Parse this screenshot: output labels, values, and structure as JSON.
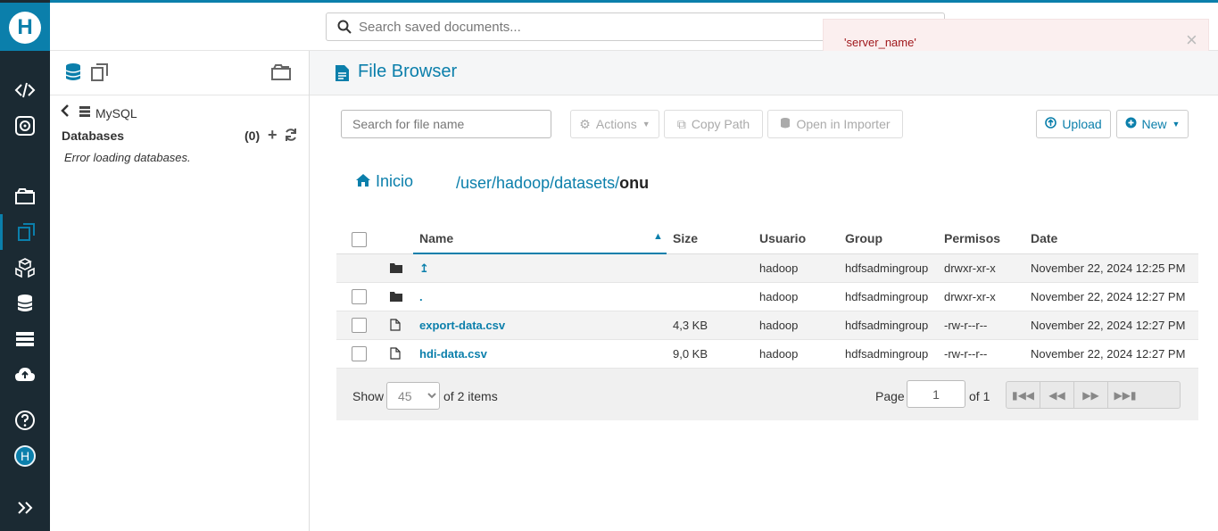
{
  "app": {
    "logo_letter": "H"
  },
  "rail": {
    "avatar_letter": "H"
  },
  "search": {
    "placeholder": "Search saved documents..."
  },
  "toast": {
    "message": "'server_name'",
    "close": "×"
  },
  "assist": {
    "crumb": "MySQL",
    "databases_label": "Databases",
    "databases_count": "(0)",
    "error": "Error loading databases."
  },
  "page": {
    "title": "File Browser"
  },
  "toolbar": {
    "file_search_placeholder": "Search for file name",
    "actions": "Actions",
    "copy_path": "Copy Path",
    "open_importer": "Open in Importer",
    "upload": "Upload",
    "new": "New"
  },
  "breadcrumb": {
    "home": "Inicio",
    "segments": [
      "/user",
      "/hadoop",
      "/datasets",
      "/",
      "onu"
    ]
  },
  "table": {
    "columns": [
      "Name",
      "Size",
      "Usuario",
      "Group",
      "Permisos",
      "Date"
    ],
    "rows": [
      {
        "name": "↥",
        "size": "",
        "user": "hadoop",
        "group": "hdfsadmingroup",
        "perms": "drwxr-xr-x",
        "date": "November 22, 2024 12:25 PM",
        "type": "folder"
      },
      {
        "name": ".",
        "size": "",
        "user": "hadoop",
        "group": "hdfsadmingroup",
        "perms": "drwxr-xr-x",
        "date": "November 22, 2024 12:27 PM",
        "type": "folder"
      },
      {
        "name": "export-data.csv",
        "size": "4,3 KB",
        "user": "hadoop",
        "group": "hdfsadmingroup",
        "perms": "-rw-r--r--",
        "date": "November 22, 2024 12:27 PM",
        "type": "file"
      },
      {
        "name": "hdi-data.csv",
        "size": "9,0 KB",
        "user": "hadoop",
        "group": "hdfsadmingroup",
        "perms": "-rw-r--r--",
        "date": "November 22, 2024 12:27 PM",
        "type": "file"
      }
    ]
  },
  "pager": {
    "show": "Show",
    "page_size": "45",
    "of_items": "of 2 items",
    "page_label": "Page",
    "page_value": "1",
    "of_pages": "of 1"
  },
  "colors": {
    "accent": "#0b7fab",
    "rail": "#1b2a33",
    "toast_text": "#a0181c"
  }
}
